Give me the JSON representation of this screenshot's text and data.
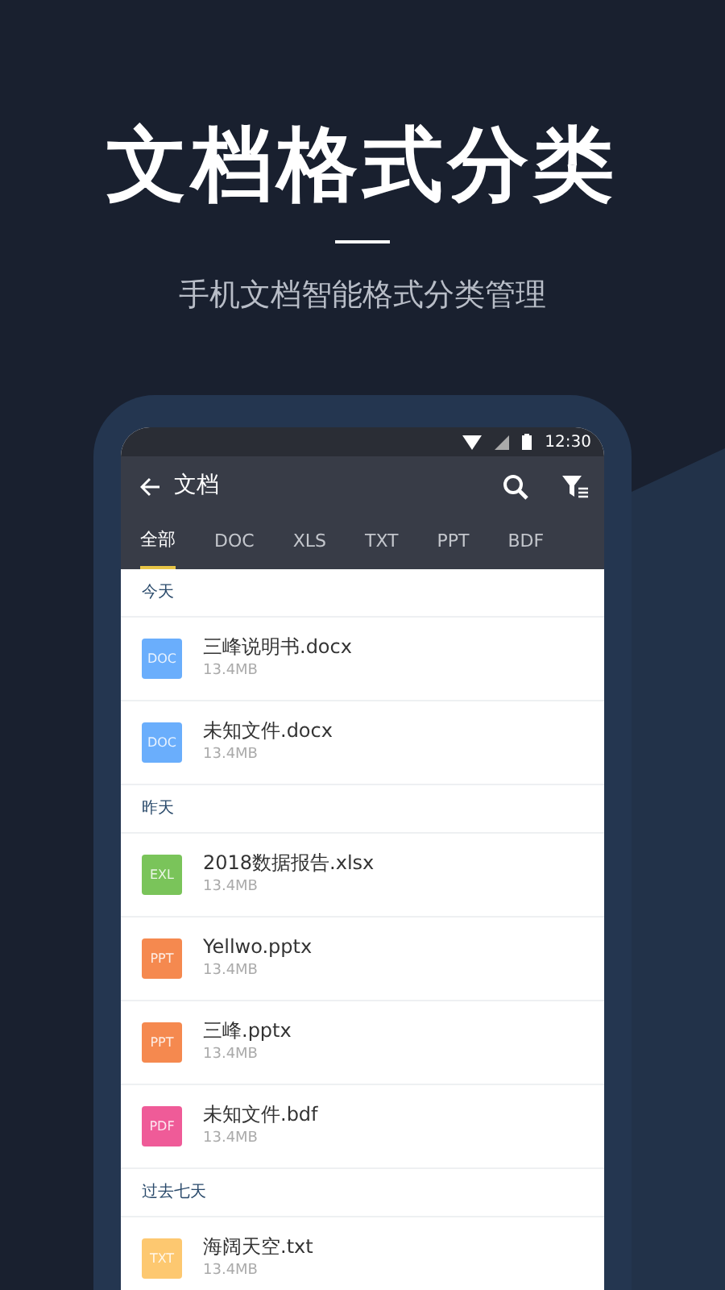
{
  "headline": "文档格式分类",
  "subtitle": "手机文档智能格式分类管理",
  "status_bar": {
    "time": "12:30"
  },
  "app_bar": {
    "title": "文档"
  },
  "tabs": [
    {
      "label": "全部",
      "selected": true
    },
    {
      "label": "DOC",
      "selected": false
    },
    {
      "label": "XLS",
      "selected": false
    },
    {
      "label": "TXT",
      "selected": false
    },
    {
      "label": "PPT",
      "selected": false
    },
    {
      "label": "BDF",
      "selected": false
    }
  ],
  "sections": [
    {
      "title": "今天",
      "files": [
        {
          "badge": "DOC",
          "color": "#6aaefc",
          "name": "三峰说明书.docx",
          "size": "13.4MB"
        },
        {
          "badge": "DOC",
          "color": "#6aaefc",
          "name": "未知文件.docx",
          "size": "13.4MB"
        }
      ]
    },
    {
      "title": "昨天",
      "files": [
        {
          "badge": "EXL",
          "color": "#7ac45a",
          "name": "2018数据报告.xlsx",
          "size": "13.4MB"
        },
        {
          "badge": "PPT",
          "color": "#f5894f",
          "name": "Yellwo.pptx",
          "size": "13.4MB"
        },
        {
          "badge": "PPT",
          "color": "#f5894f",
          "name": "三峰.pptx",
          "size": "13.4MB"
        },
        {
          "badge": "PDF",
          "color": "#ef5b98",
          "name": "未知文件.bdf",
          "size": "13.4MB"
        }
      ]
    },
    {
      "title": "过去七天",
      "files": [
        {
          "badge": "TXT",
          "color": "#fdc870",
          "name": "海阔天空.txt",
          "size": "13.4MB"
        }
      ]
    }
  ]
}
